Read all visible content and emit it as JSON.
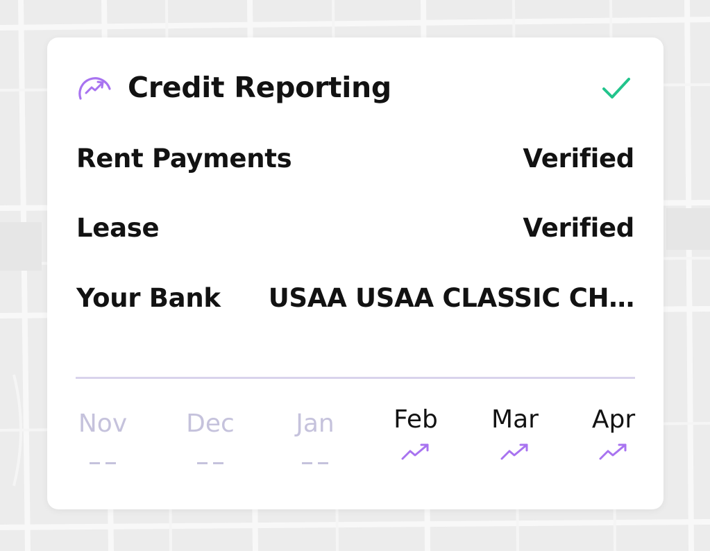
{
  "colors": {
    "accent_purple": "#a873f0",
    "check_green": "#22c48c",
    "text_dark": "#121212",
    "text_inactive": "#c5c2dc",
    "divider": "#d9d3ec",
    "card_bg": "#ffffff"
  },
  "header": {
    "icon": "credit-trend-gauge-icon",
    "title": "Credit Reporting",
    "status_icon": "checkmark-icon"
  },
  "rows": [
    {
      "label": "Rent Payments",
      "value": "Verified"
    },
    {
      "label": "Lease",
      "value": "Verified"
    },
    {
      "label": "Your Bank",
      "value": "USAA USAA CLASSIC CH…"
    }
  ],
  "months": [
    {
      "name": "Nov",
      "status": "--",
      "active": false
    },
    {
      "name": "Dec",
      "status": "--",
      "active": false
    },
    {
      "name": "Jan",
      "status": "--",
      "active": false
    },
    {
      "name": "Feb",
      "status": "trending-up-icon",
      "active": true
    },
    {
      "name": "Mar",
      "status": "trending-up-icon",
      "active": true
    },
    {
      "name": "Apr",
      "status": "trending-up-icon",
      "active": true
    }
  ]
}
